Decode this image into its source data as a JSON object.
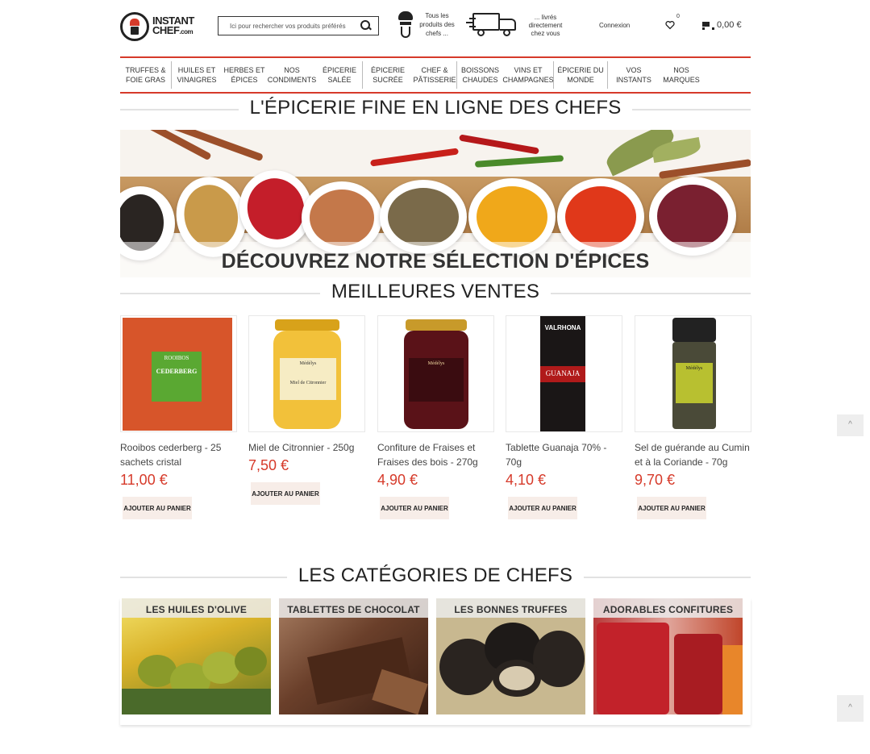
{
  "header": {
    "logo_line1": "INSTANT",
    "logo_line2": "CHEF",
    "logo_suffix": ".com",
    "search_placeholder": "Ici pour rechercher vos produits préférés",
    "promo_chefs": "Tous les produits des chefs ...",
    "promo_delivery": "... livrés directement chez vous",
    "login": "Connexion",
    "wishlist_count": "0",
    "cart_total": "0,00 €"
  },
  "nav": {
    "items": [
      {
        "label": "Truffes & Foie gras"
      },
      {
        "label": "Huiles et vinaigres"
      },
      {
        "label": "Herbes et épices"
      },
      {
        "label": "Nos condiments"
      },
      {
        "label": "Épicerie salée"
      },
      {
        "label": "Épicerie sucrée"
      },
      {
        "label": "Chef & Pâtisserie"
      },
      {
        "label": "Boissons chaudes"
      },
      {
        "label": "Vins et champagnes"
      },
      {
        "label": "Épicerie du monde"
      },
      {
        "label": "Vos instants"
      },
      {
        "label": "Nos marques"
      }
    ]
  },
  "titles": {
    "main": "L'ÉPICERIE FINE EN LIGNE DES CHEFS",
    "best": "MEILLEURES VENTES",
    "cats": "LES CATÉGORIES DE CHEFS"
  },
  "banner": {
    "caption": "DÉCOUVREZ NOTRE SÉLECTION D'ÉPICES"
  },
  "products": [
    {
      "name": "Rooibos cederberg - 25 sachets cristal",
      "price": "11,00 €",
      "button": "AJOUTER AU PANIER",
      "label_top": "ROOIBOS",
      "label_main": "CEDERBERG"
    },
    {
      "name": "Miel de Citronnier - 250g",
      "price": "7,50 €",
      "button": "AJOUTER AU PANIER",
      "label_top": "Médélys",
      "label_main": "Miel de Citronnier"
    },
    {
      "name": "Confiture de Fraises et Fraises des bois - 270g",
      "price": "4,90 €",
      "button": "AJOUTER AU PANIER",
      "label_top": "Médélys",
      "label_main": ""
    },
    {
      "name": "Tablette Guanaja 70% - 70g",
      "price": "4,10 €",
      "button": "AJOUTER AU PANIER",
      "label_top": "VALRHONA",
      "label_main": "GUANAJA"
    },
    {
      "name": "Sel de guérande au Cumin et à la Coriande - 70g",
      "price": "9,70 €",
      "button": "AJOUTER AU PANIER",
      "label_top": "Médélys",
      "label_main": ""
    }
  ],
  "categories": [
    {
      "label": "LES HUILES D'OLIVE"
    },
    {
      "label": "TABLETTES DE CHOCOLAT"
    },
    {
      "label": "LES BONNES TRUFFES"
    },
    {
      "label": "ADORABLES CONFITURES"
    }
  ],
  "colors": {
    "accent": "#d63a2a",
    "button_bg": "#f7ede8"
  }
}
